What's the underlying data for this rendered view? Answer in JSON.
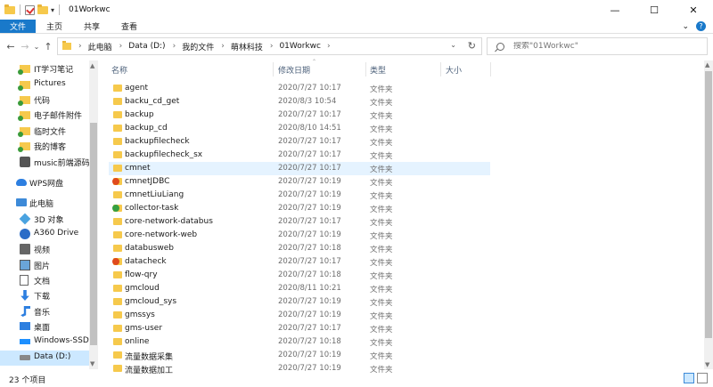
{
  "window": {
    "title": "01Workwc",
    "minimize": "—",
    "maximize": "☐",
    "close": "✕"
  },
  "ribbon": {
    "tabs": [
      {
        "label": "文件",
        "active": true
      },
      {
        "label": "主页"
      },
      {
        "label": "共享"
      },
      {
        "label": "查看"
      }
    ],
    "expand": "⌄",
    "help": "?"
  },
  "nav": {
    "back": "←",
    "forward": "→",
    "recent": "⌄",
    "up": "↑",
    "breadcrumb": [
      "此电脑",
      "Data (D:)",
      "我的文件",
      "萌林科技",
      "01Workwc"
    ],
    "chevron": "›",
    "dropdown": "⌄",
    "refresh": "↻"
  },
  "search": {
    "placeholder": "搜索\"01Workwc\""
  },
  "sidebar": {
    "items": [
      {
        "label": "IT学习笔记",
        "icon": "pinned-folder-icon"
      },
      {
        "label": "Pictures",
        "icon": "pinned-folder-icon"
      },
      {
        "label": "代码",
        "icon": "pinned-folder-icon"
      },
      {
        "label": "电子邮件附件",
        "icon": "pinned-folder-icon"
      },
      {
        "label": "临时文件",
        "icon": "pinned-folder-icon"
      },
      {
        "label": "我的博客",
        "icon": "pinned-folder-icon"
      },
      {
        "label": "music前端源码",
        "icon": "music-folder-icon"
      },
      {
        "label": "WPS网盘",
        "icon": "cloud-icon"
      },
      {
        "label": "此电脑",
        "icon": "computer-icon"
      },
      {
        "label": "3D 对象",
        "icon": "3d-objects-icon"
      },
      {
        "label": "A360 Drive",
        "icon": "a360-drive-icon"
      },
      {
        "label": "视频",
        "icon": "videos-icon"
      },
      {
        "label": "图片",
        "icon": "pictures-icon"
      },
      {
        "label": "文档",
        "icon": "documents-icon"
      },
      {
        "label": "下载",
        "icon": "downloads-icon"
      },
      {
        "label": "音乐",
        "icon": "music-icon"
      },
      {
        "label": "桌面",
        "icon": "desktop-icon"
      },
      {
        "label": "Windows-SSD",
        "icon": "windows-drive-icon"
      },
      {
        "label": "Data (D:)",
        "icon": "drive-icon",
        "selected": true
      }
    ]
  },
  "columns": {
    "name": "名称",
    "modified": "修改日期",
    "type": "类型",
    "size": "大小"
  },
  "files": [
    {
      "name": "agent",
      "modified": "2020/7/27 10:17",
      "type": "文件夹",
      "badge": ""
    },
    {
      "name": "backu_cd_get",
      "modified": "2020/8/3 10:54",
      "type": "文件夹",
      "badge": ""
    },
    {
      "name": "backup",
      "modified": "2020/7/27 10:17",
      "type": "文件夹",
      "badge": ""
    },
    {
      "name": "backup_cd",
      "modified": "2020/8/10 14:51",
      "type": "文件夹",
      "badge": ""
    },
    {
      "name": "backupfilecheck",
      "modified": "2020/7/27 10:17",
      "type": "文件夹",
      "badge": ""
    },
    {
      "name": "backupfilecheck_sx",
      "modified": "2020/7/27 10:17",
      "type": "文件夹",
      "badge": ""
    },
    {
      "name": "cmnet",
      "modified": "2020/7/27 10:17",
      "type": "文件夹",
      "badge": "",
      "selected": true
    },
    {
      "name": "cmnetJDBC",
      "modified": "2020/7/27 10:19",
      "type": "文件夹",
      "badge": "red"
    },
    {
      "name": "cmnetLiuLiang",
      "modified": "2020/7/27 10:19",
      "type": "文件夹",
      "badge": ""
    },
    {
      "name": "collector-task",
      "modified": "2020/7/27 10:19",
      "type": "文件夹",
      "badge": "green"
    },
    {
      "name": "core-network-databus",
      "modified": "2020/7/27 10:17",
      "type": "文件夹",
      "badge": ""
    },
    {
      "name": "core-network-web",
      "modified": "2020/7/27 10:19",
      "type": "文件夹",
      "badge": ""
    },
    {
      "name": "databusweb",
      "modified": "2020/7/27 10:18",
      "type": "文件夹",
      "badge": ""
    },
    {
      "name": "datacheck",
      "modified": "2020/7/27 10:17",
      "type": "文件夹",
      "badge": "red"
    },
    {
      "name": "flow-qry",
      "modified": "2020/7/27 10:18",
      "type": "文件夹",
      "badge": ""
    },
    {
      "name": "gmcloud",
      "modified": "2020/8/11 10:21",
      "type": "文件夹",
      "badge": ""
    },
    {
      "name": "gmcloud_sys",
      "modified": "2020/7/27 10:19",
      "type": "文件夹",
      "badge": ""
    },
    {
      "name": "gmssys",
      "modified": "2020/7/27 10:19",
      "type": "文件夹",
      "badge": ""
    },
    {
      "name": "gms-user",
      "modified": "2020/7/27 10:17",
      "type": "文件夹",
      "badge": ""
    },
    {
      "name": "online",
      "modified": "2020/7/27 10:18",
      "type": "文件夹",
      "badge": ""
    },
    {
      "name": "流量数据采集",
      "modified": "2020/7/27 10:19",
      "type": "文件夹",
      "badge": ""
    },
    {
      "name": "流量数据加工",
      "modified": "2020/7/27 10:19",
      "type": "文件夹",
      "badge": ""
    }
  ],
  "status": {
    "count": "23 个项目"
  },
  "colors": {
    "accent": "#1979ca",
    "selection": "#cce8ff",
    "hover": "#e5f3ff",
    "folder": "#f6c94c"
  }
}
